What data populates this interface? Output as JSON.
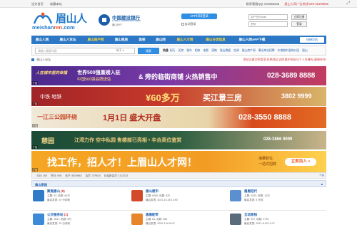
{
  "topbar": {
    "links": [
      "设为首页",
      "收藏本站"
    ],
    "service": "联系客服QQ: 541555345",
    "ad_hotline": "眉山人网广告热线:028-38199655"
  },
  "header": {
    "logo_cn": "眉山人",
    "logo_en_prefix": "meishan",
    "logo_en_accent": "ren",
    "logo_en_suffix": ".com",
    "bank_name": "中国建设银行",
    "bank_en": "China Construction Bank",
    "bank_sub": "眉山分行",
    "app_button": "APP扫码登录",
    "remember": "自动登录",
    "user_placeholder": "用户名/Email",
    "pass_placeholder": "密码",
    "register_label": "立即注册",
    "login_label": "登录"
  },
  "nav": {
    "items": [
      {
        "label": "眉山人网",
        "hot": false
      },
      {
        "label": "眉山人论坛",
        "hot": false
      },
      {
        "label": "眉山房产网",
        "hot": true
      },
      {
        "label": "眉山租房",
        "hot": false
      },
      {
        "label": "装修",
        "hot": false
      },
      {
        "label": "眉山网",
        "hot": false
      },
      {
        "label": "眉山人才网",
        "hot": true
      },
      {
        "label": "眉山分类信息",
        "hot": true
      },
      {
        "label": "眉山人网APP下载",
        "hot": false
      }
    ],
    "quick": "快捷导航"
  },
  "search": {
    "placeholder": "请输入搜索内容",
    "type": "帖子",
    "button": "搜索",
    "hot_label": "热搜:",
    "hot_terms": [
      "招行",
      "买房",
      "租车",
      "相亲",
      "电影",
      "宠物",
      "眉山晚报",
      "空调",
      "眉山房产网",
      "事业单位招聘",
      "东坡城市湿地公园",
      "眉山",
      "公务员",
      "住房公积金",
      "鑫鑫家园",
      "东坡区",
      "外卖",
      "东坡区",
      "二手房",
      "东方红"
    ]
  },
  "crumb": {
    "path": "眉山人论坛",
    "notice": "发帖注意文明用语,杜绝违反法律,维护网站与个人名誉权,谢谢合作!"
  },
  "banners": {
    "b1": {
      "a": "人在城市里的幸福",
      "b": "世界500强重磅入驻",
      "c": "中国500强品牌进驻",
      "d": "& 旁的临街商铺 火热销售中",
      "tel": "028-3689 8888"
    },
    "b2": {
      "a": "中铁·地铁",
      "b": "¥60多万",
      "c": "买江景三房",
      "tel": "3802 9999"
    },
    "b3": {
      "a": "一江三公园环绕",
      "b": "1月1日  盛大开盘",
      "tel": "028-3550 8888"
    },
    "b4": {
      "a": "憩园",
      "b": "江湾力作  空中私园  售楼部已亮相 • 丰合高位鉴赏",
      "tel": "028-3866 9999"
    },
    "b5": {
      "a": "找工作，招人才！上眉山人才网！",
      "b": "海量职位,",
      "c": "一站式招聘",
      "btn": "立即加入 »"
    },
    "tag": "广告"
  },
  "stats": {
    "today": "今日: 306",
    "yesterday": "昨日: 695",
    "posts": "帖子: 8209882",
    "members": "会员: 379615",
    "newest": "欢迎新会员: 1112223"
  },
  "section": {
    "title": "眉山家园",
    "forums": [
      {
        "name": "聚焦眉山",
        "count": "(8)",
        "stats": "主题: 43, 帖数: 60万",
        "last": "最后发表: 19 分钟前",
        "color": "#2f7bc8"
      },
      {
        "name": "眉山楼市",
        "count": "",
        "stats": "主题: 6280, 帖数: 6万",
        "last": "最后发表: 2021-10-26 13:50",
        "color": "#d34a2a"
      },
      {
        "name": "眉眉招代",
        "count": "",
        "stats": "主题: 4333, 帖数: 13万",
        "last": "最后发表: 4 天前",
        "color": "#5a8fd0"
      },
      {
        "name": "公交服务站",
        "count": "(1)",
        "stats": "主题: 1647, 帖数: 5万",
        "last": "最后发表: 25 分钟前",
        "color": "#3c8ad8"
      },
      {
        "name": "眉眉配笑",
        "count": "",
        "stats": "主题: 84, 帖数: 382",
        "last": "最后发表: 2022-1-8 00:47",
        "color": "#e8842a"
      },
      {
        "name": "互动客栈",
        "count": "",
        "stats": "主题: 257, 帖数: 2733",
        "last": "最后发表: 2021-8-20 12:47",
        "color": "#5a6b7c"
      }
    ]
  }
}
